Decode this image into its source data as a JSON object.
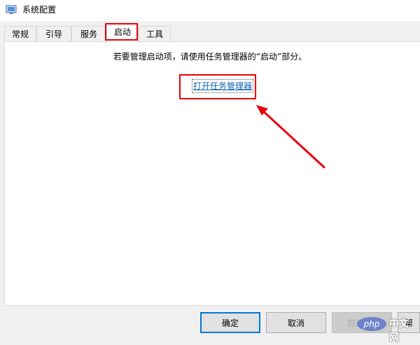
{
  "window": {
    "title": "系统配置",
    "icon": "msconfig-icon"
  },
  "tabs": [
    {
      "label": "常规",
      "active": false
    },
    {
      "label": "引导",
      "active": false
    },
    {
      "label": "服务",
      "active": false
    },
    {
      "label": "启动",
      "active": true
    },
    {
      "label": "工具",
      "active": false
    }
  ],
  "startup_panel": {
    "info_text": "若要管理启动项，请使用任务管理器的“启动”部分。",
    "link_text": "打开任务管理器"
  },
  "buttons": {
    "ok": "确定",
    "cancel": "取消",
    "apply": "应用(A)",
    "help": "帮"
  },
  "watermark": {
    "logo": "php",
    "site": "中文网"
  },
  "colors": {
    "highlight": "#e8000b",
    "link": "#0b62b4",
    "primary_button_border": "#0078d7"
  }
}
